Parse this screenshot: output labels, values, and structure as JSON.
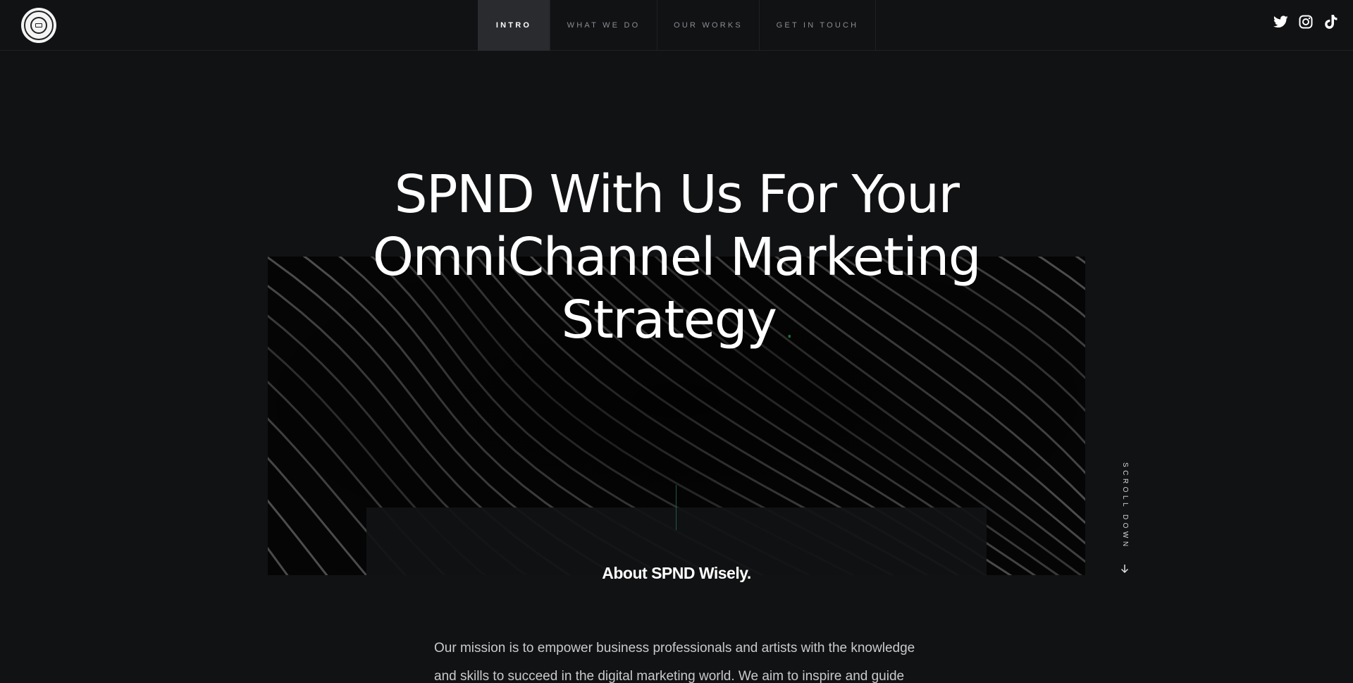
{
  "header": {
    "logo_icon": "circular-seal-logo",
    "nav": [
      {
        "label": "INTRO",
        "active": true
      },
      {
        "label": "WHAT WE DO",
        "active": false
      },
      {
        "label": "OUR WORKS",
        "active": false
      },
      {
        "label": "GET IN TOUCH",
        "active": false
      }
    ],
    "social": [
      "twitter-icon",
      "instagram-icon",
      "tiktok-icon"
    ]
  },
  "hero": {
    "title_line1": "SPND With Us For Your",
    "title_line2": "OmniChannel Marketing",
    "title_line3": "Strategy",
    "accent_dot": "."
  },
  "scroll": {
    "label": "SCROLL DOWN",
    "icon": "arrow-down-icon"
  },
  "about": {
    "title": "About SPND Wisely.",
    "text": "Our mission is to empower business professionals and artists with the knowledge and skills to succeed in the digital marketing world. We aim to inspire and guide"
  },
  "colors": {
    "background": "#111214",
    "accent_green": "#1a7a3a",
    "nav_active_bg": "#2a2b2e"
  }
}
